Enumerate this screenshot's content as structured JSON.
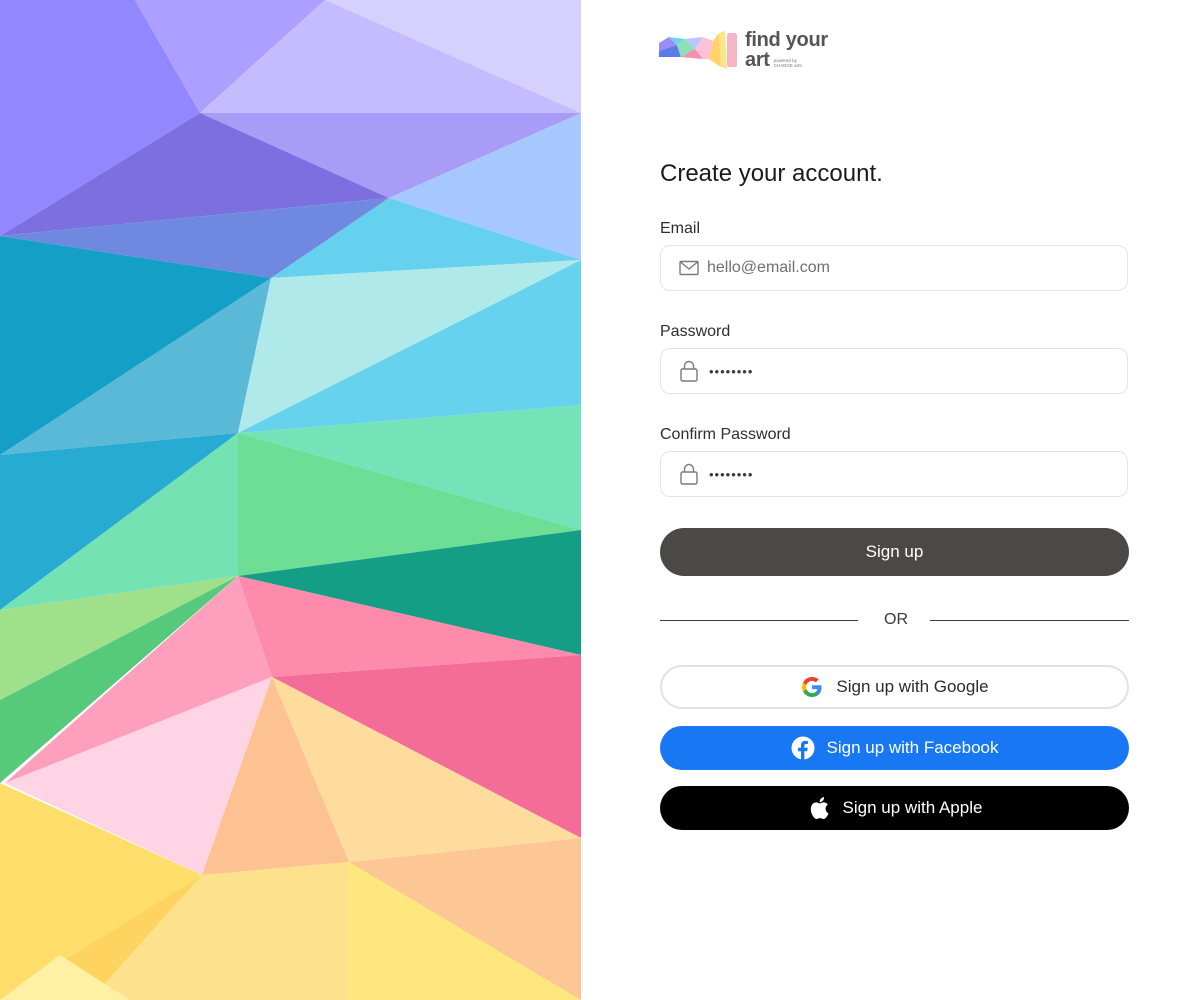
{
  "brand": {
    "name_line1": "find your",
    "name_line2": "art",
    "powered_by": "powered by",
    "powered_by_company": "CHANGE arts"
  },
  "form": {
    "title": "Create your account.",
    "email": {
      "label": "Email",
      "value": "hello@email.com",
      "icon": "mail-icon"
    },
    "password": {
      "label": "Password",
      "value": "••••••••",
      "icon": "lock-icon"
    },
    "confirm_password": {
      "label": "Confirm Password",
      "value": "••••••••",
      "icon": "lock-icon"
    },
    "submit_label": "Sign up",
    "divider_text": "OR"
  },
  "social": {
    "google": {
      "label": "Sign up with Google",
      "icon": "google-icon"
    },
    "facebook": {
      "label": "Sign up with Facebook",
      "icon": "facebook-icon",
      "color": "#1877F2"
    },
    "apple": {
      "label": "Sign up with Apple",
      "icon": "apple-icon",
      "color": "#000000"
    }
  },
  "colors": {
    "primary_button": "#4A4947",
    "facebook": "#1877F2",
    "apple": "#000000"
  }
}
